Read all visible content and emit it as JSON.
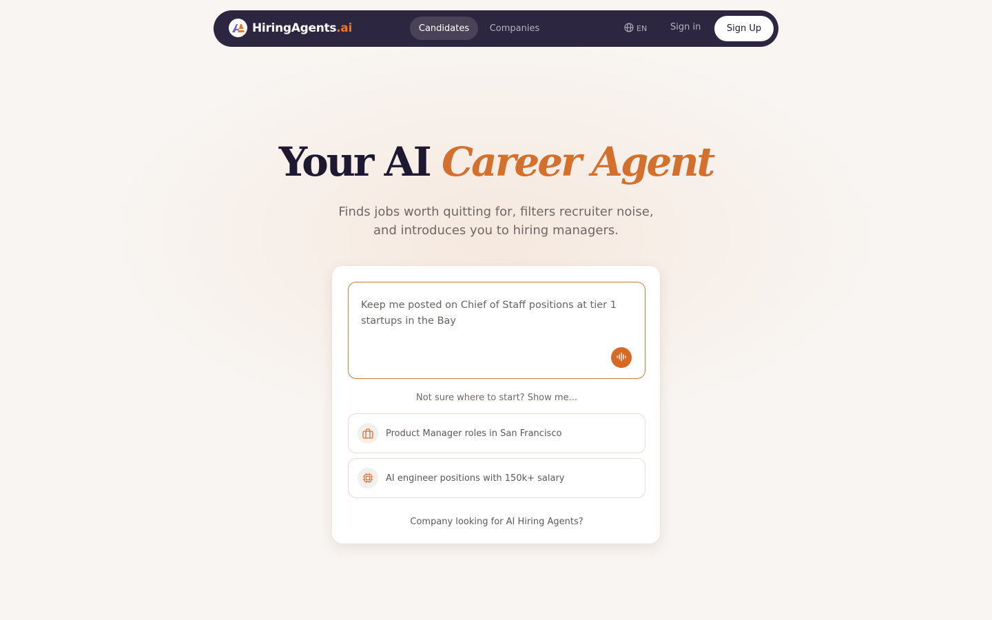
{
  "brand": {
    "name": "HiringAgents",
    "tld": ".ai",
    "logo_icon": "ha-logo-icon"
  },
  "nav": {
    "tabs": [
      {
        "label": "Candidates",
        "active": true
      },
      {
        "label": "Companies",
        "active": false
      }
    ],
    "language": {
      "icon": "globe-icon",
      "label": "EN"
    },
    "sign_in": "Sign in",
    "sign_up": "Sign Up"
  },
  "hero": {
    "title_plain": "Your AI",
    "title_accent": "Career Agent",
    "subtitle_line1": "Finds jobs worth quitting for, filters recruiter noise,",
    "subtitle_line2": "and introduces you to hiring managers."
  },
  "card": {
    "prompt_value": "Keep me posted on Chief of Staff positions at tier 1 startups in the Bay",
    "mic_icon": "audio-waveform-icon",
    "hint": "Not sure where to start? Show me...",
    "suggestions": [
      {
        "icon": "briefcase-icon",
        "label": "Product Manager roles in San Francisco"
      },
      {
        "icon": "chip-icon",
        "label": "AI engineer positions with 150k+ salary"
      }
    ],
    "company_link": "Company looking for AI Hiring Agents?"
  },
  "colors": {
    "nav_bg": "#2d2640",
    "accent": "#d3702e",
    "page_bg": "#f8f5f2",
    "mic_bg": "#d66a24"
  }
}
